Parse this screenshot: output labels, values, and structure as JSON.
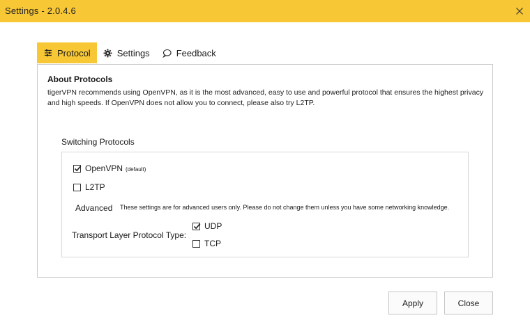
{
  "window": {
    "title": "Settings - ",
    "version": "2.0.4.6"
  },
  "tabs": [
    {
      "label": "Protocol",
      "icon": "sliders-icon",
      "active": true
    },
    {
      "label": "Settings",
      "icon": "gear-icon",
      "active": false
    },
    {
      "label": "Feedback",
      "icon": "speech-bubble-icon",
      "active": false
    }
  ],
  "about": {
    "heading": "About Protocols",
    "text": "tigerVPN recommends using OpenVPN, as it is the most advanced, easy to use and powerful protocol that ensures the highest privacy and high speeds. If OpenVPN does not allow you to connect, please also try L2TP."
  },
  "switching": {
    "heading": "Switching Protocols",
    "openvpn_label": "OpenVPN",
    "openvpn_note": "(default)",
    "openvpn_checked": true,
    "l2tp_label": "L2TP",
    "l2tp_checked": false,
    "advanced_label": "Advanced",
    "advanced_note": "These settings are for advanced users only. Please do not change them unless you have some networking knowledge.",
    "transport_label": "Transport Layer Protocol Type:",
    "udp_label": "UDP",
    "udp_checked": true,
    "tcp_label": "TCP",
    "tcp_checked": false
  },
  "buttons": {
    "apply": "Apply",
    "close": "Close"
  },
  "colors": {
    "accent": "#f8c735"
  }
}
